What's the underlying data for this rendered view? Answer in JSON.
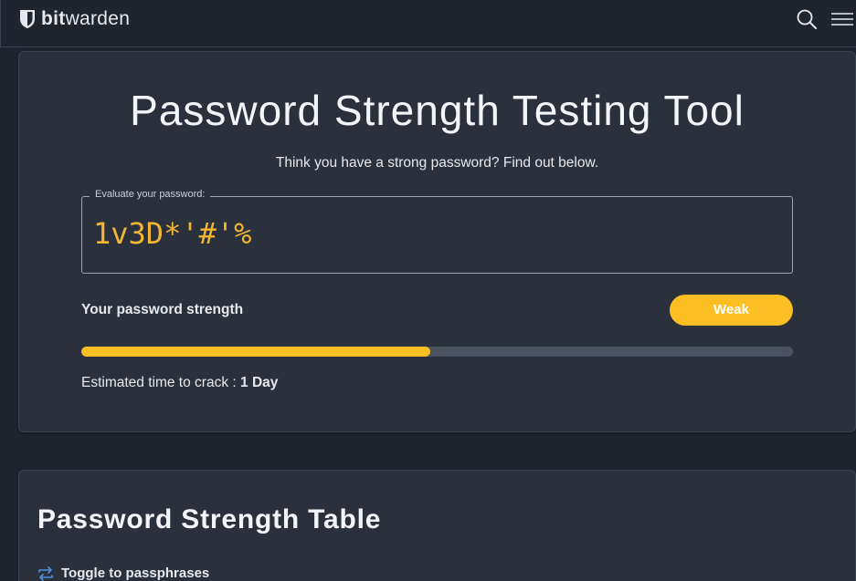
{
  "header": {
    "logo_bold": "bit",
    "logo_regular": "warden"
  },
  "main": {
    "title": "Password Strength Testing Tool",
    "subtitle": "Think you have a strong password? Find out below.",
    "field_label": "Evaluate your password:",
    "password_value": "1v3D*'#'%",
    "strength_label": "Your password strength",
    "strength_badge": "Weak",
    "strength_fraction": 0.49,
    "crack_label": "Estimated time to crack :",
    "crack_value": "1 Day"
  },
  "table_section": {
    "title": "Password Strength Table",
    "toggle_label": "Toggle to passphrases"
  },
  "colors": {
    "accent": "#fbbf24",
    "badge": "#fbbf24",
    "password_text": "#f2b632",
    "link_icon": "#4f8fe0"
  },
  "icons": {
    "logo": "shield-icon",
    "search": "search-icon",
    "menu": "hamburger-menu-icon",
    "toggle": "swap-arrows-icon"
  }
}
